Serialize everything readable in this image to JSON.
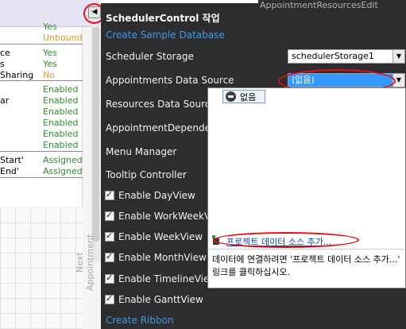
{
  "designer": {
    "properties": [
      {
        "key": "",
        "value": "Yes",
        "color": "#2e8b2e"
      },
      {
        "key": "",
        "value": "Unbound",
        "color": "#d89a1c"
      },
      {
        "key": "ce",
        "value": "Yes",
        "color": "#2e8b2e"
      },
      {
        "key": "s",
        "value": "Yes",
        "color": "#2e8b2e"
      },
      {
        "key": " Sharing",
        "value": "No",
        "color": "#d89a1c"
      },
      {
        "key": "",
        "value": "Enabled",
        "color": "#2e8b2e"
      },
      {
        "key": "ar",
        "value": "Enabled",
        "color": "#2e8b2e"
      },
      {
        "key": "",
        "value": "Enabled",
        "color": "#2e8b2e"
      },
      {
        "key": "",
        "value": "Enabled",
        "color": "#2e8b2e"
      },
      {
        "key": "",
        "value": "Enabled",
        "color": "#2e8b2e"
      },
      {
        "key": "",
        "value": "Enabled",
        "color": "#2e8b2e"
      },
      {
        "key": "Start'",
        "value": "Assigned",
        "color": "#2e8b2e"
      },
      {
        "key": "End'",
        "value": "Assigned",
        "color": "#2e8b2e"
      }
    ],
    "vertical_label": "Next Appointment",
    "smart_tag_arrow": "◀"
  },
  "panel": {
    "background_item": "AppointmentResourcesEdit",
    "title": "SchedulerControl 작업",
    "create_sample_db": "Create Sample Database",
    "scheduler_storage_label": "Scheduler Storage",
    "scheduler_storage_value": "schedulerStorage1",
    "appointments_ds_label": "Appointments  Data Source",
    "appointments_ds_value": "(없음)",
    "resources_ds_label": "Resources  Data Source",
    "appointment_dependencies_label": "AppointmentDependencies",
    "menu_manager_label": "Menu Manager",
    "tooltip_controller_label": "Tooltip Controller",
    "checkboxes": [
      {
        "label": "Enable DayView",
        "checked": true
      },
      {
        "label": "Enable WorkWeekView",
        "checked": true
      },
      {
        "label": "Enable WeekView",
        "checked": true
      },
      {
        "label": "Enable MonthView",
        "checked": true
      },
      {
        "label": "Enable TimelineView",
        "checked": true
      },
      {
        "label": "Enable GanttView",
        "checked": true
      }
    ],
    "create_ribbon": "Create Ribbon"
  },
  "popup": {
    "none_item": "없음",
    "add_project_ds": "프로젝트 데이터 소스 추가...",
    "help_text": "데이터에 연결하려면 '프로젝트 데이터 소스 추가...' 링크를 클릭하십시오."
  },
  "colors": {
    "panel_bg": "#2d2d30",
    "link": "#3c9be8",
    "highlight_ellipse": "#e0101a",
    "selected_combo": "#3399ff"
  }
}
